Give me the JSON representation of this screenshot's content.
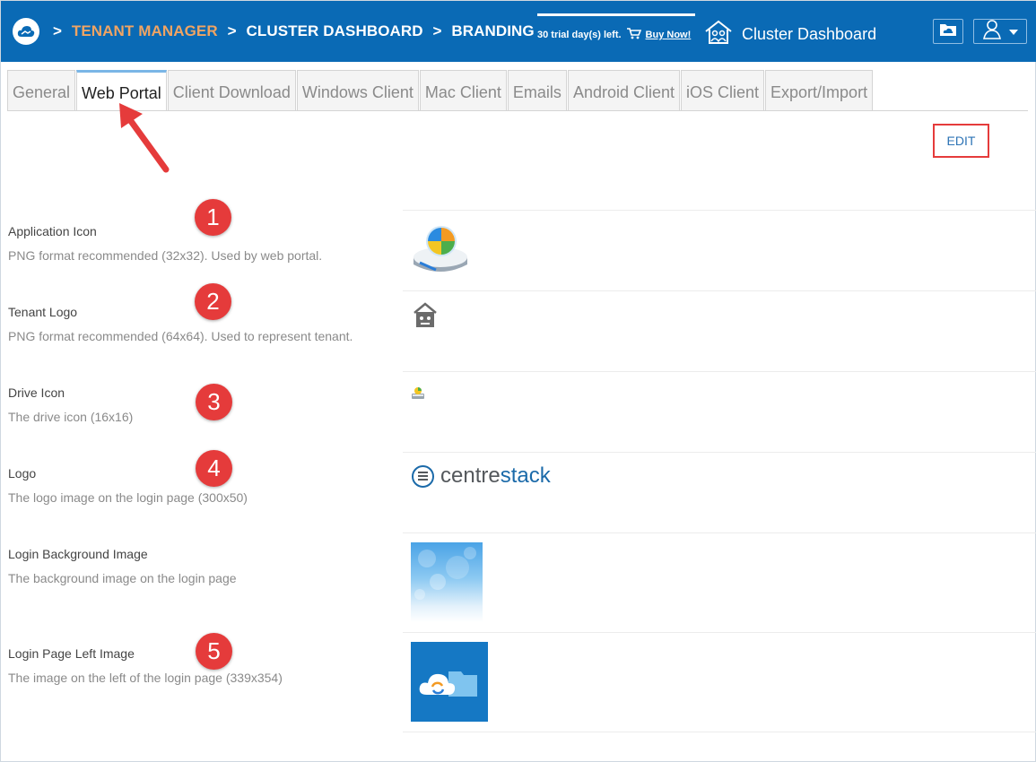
{
  "header": {
    "breadcrumb": [
      {
        "label": "TENANT MANAGER",
        "active": true
      },
      {
        "label": "CLUSTER DASHBOARD",
        "active": false
      },
      {
        "label": "BRANDING",
        "active": false
      }
    ],
    "separator": ">",
    "trial_text": "30 trial day(s) left.",
    "buy_now": "Buy Now!",
    "cluster_dashboard": "Cluster Dashboard"
  },
  "tabs": [
    {
      "label": "General",
      "active": false
    },
    {
      "label": "Web Portal",
      "active": true
    },
    {
      "label": "Client Download",
      "active": false
    },
    {
      "label": "Windows Client",
      "active": false
    },
    {
      "label": "Mac Client",
      "active": false
    },
    {
      "label": "Emails",
      "active": false
    },
    {
      "label": "Android Client",
      "active": false
    },
    {
      "label": "iOS Client",
      "active": false
    },
    {
      "label": "Export/Import",
      "active": false
    }
  ],
  "edit_label": "EDIT",
  "rows": [
    {
      "label": "Application Icon",
      "desc": "PNG format recommended (32x32). Used by web portal.",
      "badge": "1"
    },
    {
      "label": "Tenant Logo",
      "desc": "PNG format recommended (64x64). Used to represent tenant.",
      "badge": "2"
    },
    {
      "label": "Drive Icon",
      "desc": "The drive icon (16x16)",
      "badge": "3"
    },
    {
      "label": "Logo",
      "desc": "The logo image on the login page (300x50)",
      "badge": "4"
    },
    {
      "label": "Login Background Image",
      "desc": "The background image on the login page",
      "badge": ""
    },
    {
      "label": "Login Page Left Image",
      "desc": "The image on the left of the login page (339x354)",
      "badge": "5"
    }
  ],
  "logo_text": {
    "part1": "centre",
    "part2": "stack"
  },
  "colors": {
    "header_bg": "#0a6ab5",
    "breadcrumb_active": "#f0a463",
    "badge": "#e53b3b",
    "edit_link": "#2c73b5",
    "annotation": "#e53b3b"
  },
  "icons": [
    "cloud-logo-icon",
    "cart-icon",
    "house-people-icon",
    "folder-cloud-icon",
    "user-icon",
    "caret-down-icon",
    "app-drive-icon",
    "tenant-house-icon",
    "drive-icon",
    "centrestack-logo-icon",
    "cloud-folder-sync-icon"
  ]
}
